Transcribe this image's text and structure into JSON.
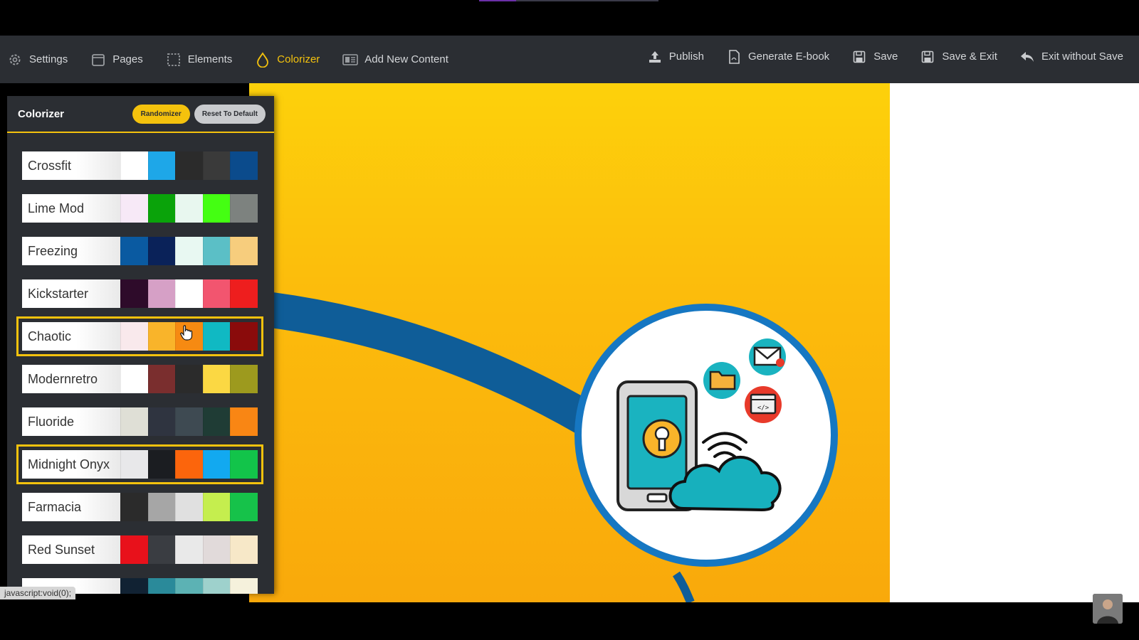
{
  "toolbar": {
    "left_items": [
      {
        "label": "Settings",
        "icon": "gear-icon"
      },
      {
        "label": "Pages",
        "icon": "page-icon"
      },
      {
        "label": "Elements",
        "icon": "dotted-square-icon"
      },
      {
        "label": "Colorizer",
        "icon": "droplet-icon",
        "active": true
      },
      {
        "label": "Add New Content",
        "icon": "content-icon"
      }
    ],
    "right_items": [
      {
        "label": "Publish",
        "icon": "upload-icon"
      },
      {
        "label": "Generate E-book",
        "icon": "document-icon"
      },
      {
        "label": "Save",
        "icon": "floppy-icon"
      },
      {
        "label": "Save & Exit",
        "icon": "floppy-icon"
      },
      {
        "label": "Exit without Save",
        "icon": "reply-arrow-icon"
      }
    ]
  },
  "colorizer": {
    "title": "Colorizer",
    "randomizer_label": "Randomizer",
    "reset_label": "Reset To Default",
    "schemes": [
      {
        "name": "Crossfit",
        "colors": [
          "#ffffff",
          "#1ea7e8",
          "#2b2b2b",
          "#3a3a3a",
          "#0b4b8c"
        ]
      },
      {
        "name": "Lime Mod",
        "colors": [
          "#f7e9f7",
          "#0aa30a",
          "#e8f7ef",
          "#44ff12",
          "#7d827f"
        ]
      },
      {
        "name": "Freezing",
        "colors": [
          "#0a5aa1",
          "#0a2259",
          "#e8f8f2",
          "#5bbfc6",
          "#f7cd7d"
        ]
      },
      {
        "name": "Kickstarter",
        "colors": [
          "#2e0b2a",
          "#d6a0c6",
          "#ffffff",
          "#f2556f",
          "#ee1e1e"
        ]
      },
      {
        "name": "Chaotic",
        "colors": [
          "#f9e9ec",
          "#f9b42a",
          "#f68a12",
          "#10b9c3",
          "#8a0b0b"
        ],
        "selected": true
      },
      {
        "name": "Modernretro",
        "colors": [
          "#ffffff",
          "#7a2e2e",
          "#2b2b2b",
          "#fbd843",
          "#9d9a1e"
        ]
      },
      {
        "name": "Fluoride",
        "colors": [
          "#dfdfd6",
          "#2f3440",
          "#3e4a52",
          "#1f3c35",
          "#f98614"
        ]
      },
      {
        "name": "Midnight Onyx",
        "colors": [
          "#e8e8ea",
          "#1b1d21",
          "#fc650c",
          "#12a9f0",
          "#12c44a"
        ],
        "selected": true
      },
      {
        "name": "Farmacia",
        "colors": [
          "#2b2b2b",
          "#a6a6a6",
          "#e0e0e0",
          "#c5ee4e",
          "#16c24a"
        ]
      },
      {
        "name": "Red Sunset",
        "colors": [
          "#e8111b",
          "#3a3d42",
          "#e9e9e9",
          "#e1dada",
          "#f7e8c8"
        ]
      },
      {
        "name": "",
        "colors": [
          "#112233",
          "#2a8a9a",
          "#5cb2b4",
          "#9ed1cc",
          "#f5f1dc"
        ]
      }
    ]
  },
  "status_bar": {
    "text": "javascript:void(0);"
  },
  "illustration": {
    "code_symbol": "</>"
  },
  "colors": {
    "toolbar_bg": "#2b2e33",
    "accent": "#f4c20d",
    "canvas_top": "#fdd10b",
    "canvas_bottom": "#f9a90b",
    "arc_blue": "#0f5d98"
  }
}
